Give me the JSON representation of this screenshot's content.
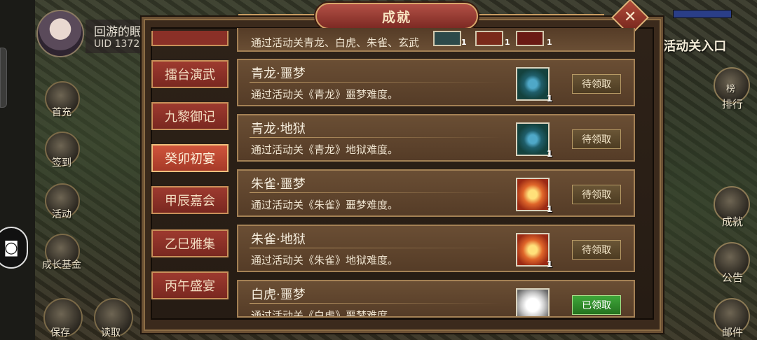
{
  "player": {
    "name": "回游的眠",
    "uid": "UID  1372"
  },
  "left_buttons": [
    {
      "label": "首充"
    },
    {
      "label": "签到"
    },
    {
      "label": "活动"
    },
    {
      "label": "成长基金"
    },
    {
      "label": "保存"
    },
    {
      "label": "读取"
    }
  ],
  "right": {
    "entry_label": "易 活动关入口",
    "buttons": [
      {
        "label": "排行",
        "badge": "榜"
      },
      {
        "label": "成就"
      },
      {
        "label": "公告"
      },
      {
        "label": "邮件"
      }
    ]
  },
  "dialog": {
    "title": "成就",
    "close_glyph": "✕",
    "tabs": [
      {
        "label": "擂台演武",
        "active": false
      },
      {
        "label": "九黎御记",
        "active": false
      },
      {
        "label": "癸卯初宴",
        "active": true
      },
      {
        "label": "甲辰嘉会",
        "active": false
      },
      {
        "label": "乙巳雅集",
        "active": false
      },
      {
        "label": "丙午盛宴",
        "active": false
      }
    ],
    "partial_row": {
      "desc": "通过活动关青龙、白虎、朱雀、玄武",
      "item_counts": [
        "1",
        "1",
        "1"
      ]
    },
    "achievements": [
      {
        "title": "青龙·噩梦",
        "desc": "通过活动关《青龙》噩梦难度。",
        "reward": "blue",
        "count": "1",
        "status": "待领取",
        "claimed": false
      },
      {
        "title": "青龙·地狱",
        "desc": "通过活动关《青龙》地狱难度。",
        "reward": "blue",
        "count": "1",
        "status": "待领取",
        "claimed": false
      },
      {
        "title": "朱雀·噩梦",
        "desc": "通过活动关《朱雀》噩梦难度。",
        "reward": "red",
        "count": "1",
        "status": "待领取",
        "claimed": false
      },
      {
        "title": "朱雀·地狱",
        "desc": "通过活动关《朱雀》地狱难度。",
        "reward": "red",
        "count": "1",
        "status": "待领取",
        "claimed": false
      },
      {
        "title": "白虎·噩梦",
        "desc": "通过活动关《白虎》噩梦难度。",
        "reward": "white",
        "count": "",
        "status": "已领取",
        "claimed": true
      }
    ]
  }
}
